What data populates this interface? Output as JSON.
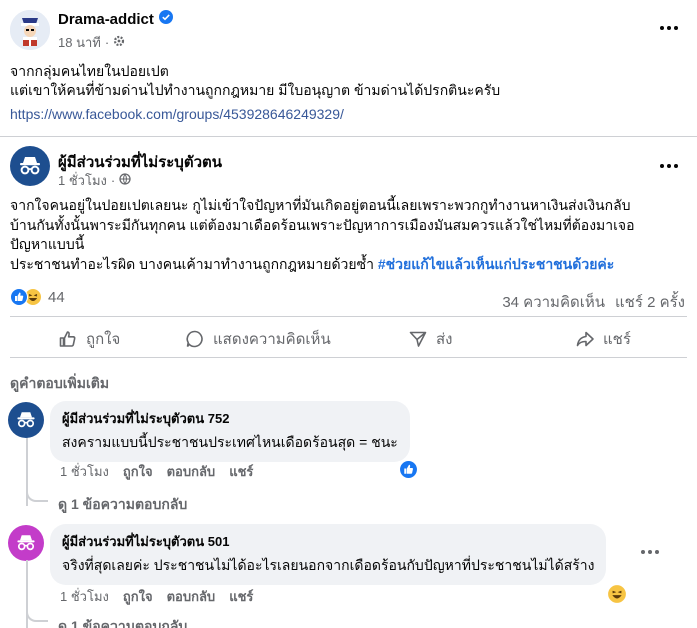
{
  "post": {
    "author": "Drama-addict",
    "time": "18 นาที",
    "dot": "·",
    "text_line1": "จากกลุ่มคนไทยในปอยเปต",
    "text_line2": "แต่เขาให้คนที่ข้ามด่านไปทำงานถูกกฎหมาย มีใบอนุญาต ข้ามด่านได้ปรกตินะครับ",
    "link": "https://www.facebook.com/groups/453928646249329/"
  },
  "shared": {
    "author": "ผู้มีส่วนร่วมที่ไม่ระบุตัวตน",
    "time": "1 ชั่วโมง",
    "dot": "·",
    "line1": "จากใจคนอยู่ในปอยเปตเลยนะ กูไม่เข้าใจปัญหาที่มันเกิดอยู่ตอนนี้เลยเพราะพวกกูทำงานหาเงินส่งเงินกลับ",
    "line2": "บ้านกันทั้งนั้นพาระมีกันทุกคน แต่ต้องมาเดือดร้อนเพราะปัญหาการเมืองมันสมควรแล้วใช่ไหมที่ต้องมาเจอ",
    "line3": "ปัญหาแบบนี้",
    "line4_text": "ประชาชนทำอะไรผิด บางคนเค้ามาทำงานถูกกฎหมายด้วยซ้ำ ",
    "hashtag": "#ช่วยแก้ไขแล้วเห็นแก่ประชาชนด้วยค่ะ",
    "reaction_count": "44",
    "comments_count": "34 ความคิดเห็น",
    "shares_count": "แชร์ 2 ครั้ง"
  },
  "actions": {
    "like": "ถูกใจ",
    "comment": "แสดงความคิดเห็น",
    "send": "ส่ง",
    "share": "แชร์"
  },
  "more_replies": "ดูคำตอบเพิ่มเติม",
  "comments": [
    {
      "author": "ผู้มีส่วนร่วมที่ไม่ระบุตัวตน 752",
      "text": "สงครามแบบนี้ประชาชนประเทศไหนเดือดร้อนสุด = ชนะ",
      "time": "1 ชั่วโมง",
      "like": "ถูกใจ",
      "reply": "ตอบกลับ",
      "share": "แชร์",
      "view_replies": "ดู 1 ข้อความตอบกลับ",
      "avatar_color": "#1d4e8f"
    },
    {
      "author": "ผู้มีส่วนร่วมที่ไม่ระบุตัวตน 501",
      "text": "จริงที่สุดเลยค่ะ ประชาชนไม่ได้อะไรเลยนอกจากเดือดร้อนกับปัญหาที่ประชาชนไม่ได้สร้าง",
      "time": "1 ชั่วโมง",
      "like": "ถูกใจ",
      "reply": "ตอบกลับ",
      "share": "แชร์",
      "view_replies": "ดู 1 ข้อความตอบกลับ",
      "avatar_color": "#c33cc9"
    }
  ],
  "colors": {
    "facebook_blue": "#1877f2",
    "anon_avatar_blue": "#1d4e8f",
    "hashtag": "#216fdb",
    "link": "#385898"
  }
}
